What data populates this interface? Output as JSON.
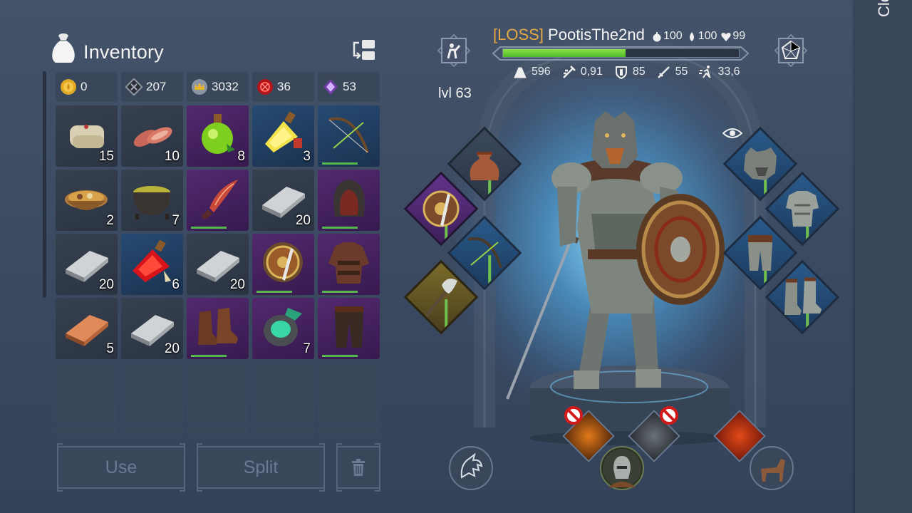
{
  "inventory": {
    "title": "Inventory",
    "resources": [
      {
        "icon": "gold-coin-icon",
        "value": "0"
      },
      {
        "icon": "iron-nugget-icon",
        "value": "207"
      },
      {
        "icon": "crown-coin-icon",
        "value": "3032"
      },
      {
        "icon": "red-seal-icon",
        "value": "36"
      },
      {
        "icon": "purple-crystal-icon",
        "value": "53"
      }
    ],
    "slots": [
      {
        "item": "bandage-icon",
        "qty": "15"
      },
      {
        "item": "raw-meat-icon",
        "qty": "10"
      },
      {
        "item": "green-potion-icon",
        "qty": "8"
      },
      {
        "item": "yellow-potion-icon",
        "qty": "3"
      },
      {
        "item": "bow-icon",
        "qty": ""
      },
      {
        "item": "stew-bowl-icon",
        "qty": "2"
      },
      {
        "item": "soup-pot-icon",
        "qty": "7"
      },
      {
        "item": "curved-dagger-icon",
        "qty": ""
      },
      {
        "item": "iron-ingot-icon",
        "qty": "20"
      },
      {
        "item": "hood-icon",
        "qty": ""
      },
      {
        "item": "iron-ingot-icon",
        "qty": "20"
      },
      {
        "item": "red-potion-icon",
        "qty": "6"
      },
      {
        "item": "iron-ingot-icon",
        "qty": "20"
      },
      {
        "item": "shield-sword-icon",
        "qty": ""
      },
      {
        "item": "leather-armor-icon",
        "qty": ""
      },
      {
        "item": "copper-ingot-icon",
        "qty": "5"
      },
      {
        "item": "iron-ingot-icon",
        "qty": "20"
      },
      {
        "item": "boots-icon",
        "qty": ""
      },
      {
        "item": "green-flask-icon",
        "qty": "7"
      },
      {
        "item": "pants-icon",
        "qty": ""
      }
    ],
    "use_label": "Use",
    "split_label": "Split"
  },
  "player": {
    "tag": "[LOSS]",
    "name": "PootisThe2nd",
    "food": "100",
    "water": "100",
    "health": "99",
    "xp_fraction": 0.52,
    "level": "lvl 63",
    "stats": [
      {
        "icon": "weight-icon",
        "value": "596"
      },
      {
        "icon": "attack-speed-icon",
        "value": "0,91"
      },
      {
        "icon": "armor-icon",
        "value": "85"
      },
      {
        "icon": "damage-icon",
        "value": "55"
      },
      {
        "icon": "run-speed-icon",
        "value": "33,6"
      }
    ]
  },
  "side_panel": {
    "label": "Clo"
  },
  "colors": {
    "tag": "#e5a842",
    "xp": "#6fd036",
    "rare": "#274a73",
    "epic": "#52296e"
  }
}
